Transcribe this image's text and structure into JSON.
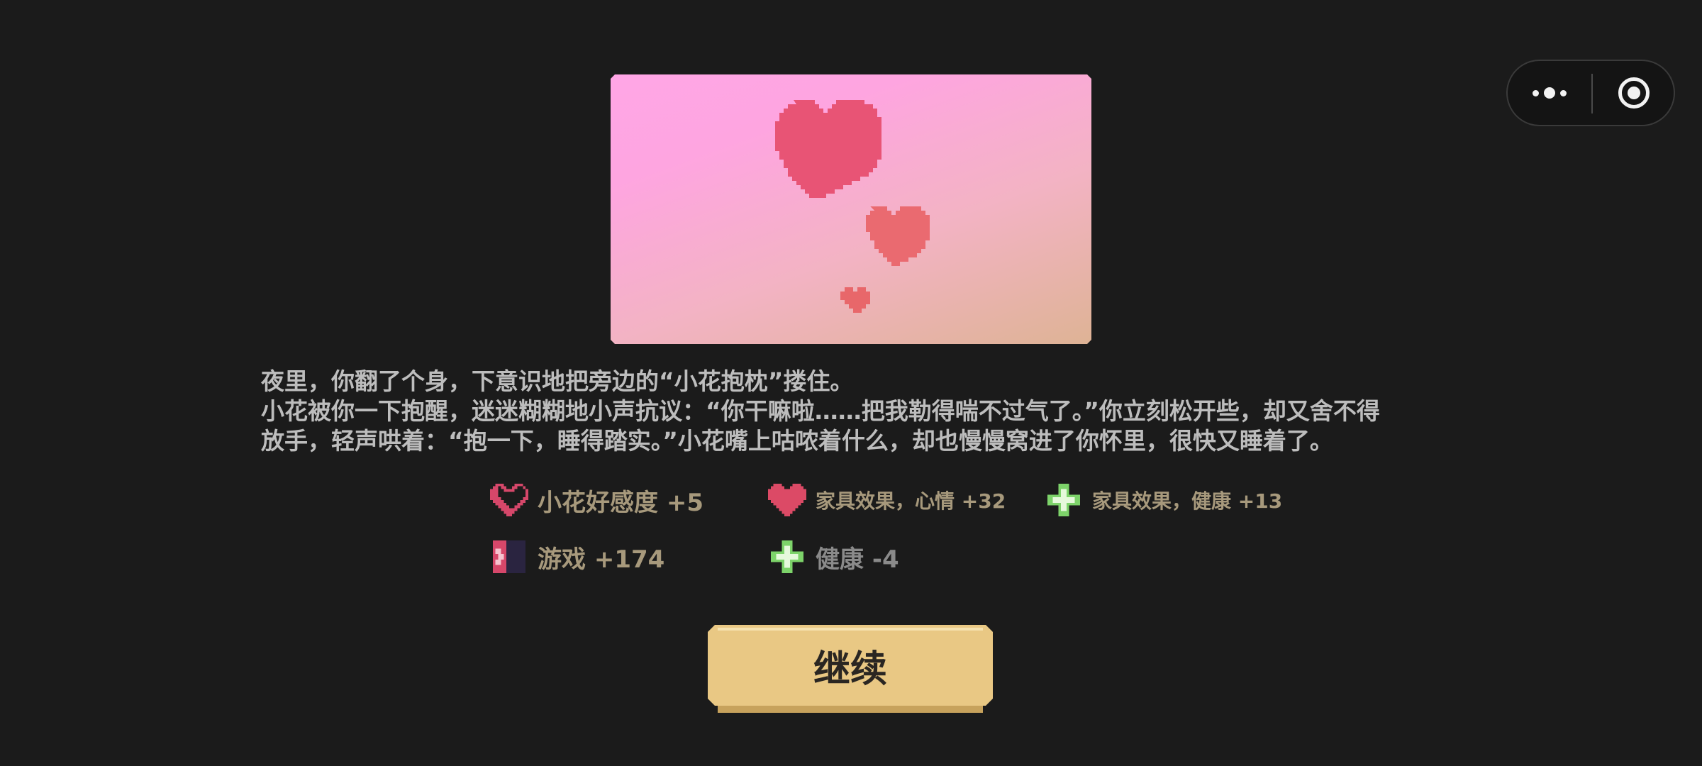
{
  "capsule": {
    "more_icon": "more-dots-icon",
    "close_icon": "target-circle-icon"
  },
  "picture": {
    "description_icon": "pixel-hearts-image",
    "colors": {
      "heart": "#e85475",
      "heart2": "#ea6a70"
    }
  },
  "story": {
    "text": "夜里，你翻了个身，下意识地把旁边的“小花抱枕”搂住。\n小花被你一下抱醒，迷迷糊糊地小声抗议：“你干嘛啦……把我勒得喘不过气了。”你立刻松开些，却又舍不得\n放手，轻声哄着：“抱一下，睡得踏实。”小花嘴上咕哝着什么，却也慢慢窝进了你怀里，很快又睡着了。"
  },
  "effects": [
    {
      "icon": "heart-outline-icon",
      "label": "小花好感度 +5"
    },
    {
      "icon": "heart-filled-icon",
      "label": "家具效果，心情 +32"
    },
    {
      "icon": "green-cross-icon",
      "label": "家具效果，健康 +13"
    },
    {
      "icon": "game-icon",
      "label": "游戏 +174"
    },
    {
      "icon": "green-cross-icon",
      "label": "健康 -4"
    }
  ],
  "continue_button": {
    "label": "继续"
  }
}
